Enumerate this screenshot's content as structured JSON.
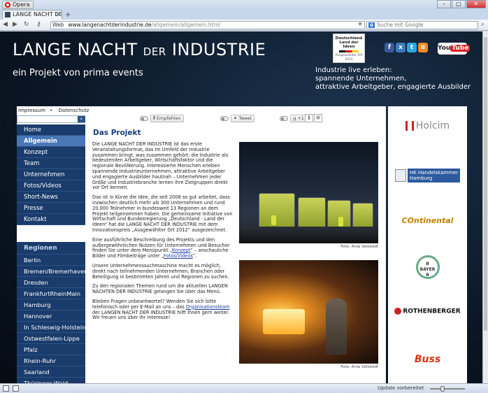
{
  "browser": {
    "app_button": "Opera",
    "tab_title": "LANGE NACHT DER IN...",
    "address_label": "Web",
    "url_host": "www.langenachtderindustrie.de",
    "url_path": "/allgemein/allgemein.html",
    "search_placeholder": "Suche mit Google",
    "status_text": "Update vorbereitet"
  },
  "header": {
    "title_part1": "LANGE NA",
    "title_c": "C",
    "title_part2": "HT",
    "title_der": "DER",
    "title_part3": "INDUSTRIE",
    "subtitle": "ein Projekt von prima events",
    "badge_line1": "Deutschland",
    "badge_line2": "Land der Ideen",
    "badge_line3": "Ausgewählter Ort 2012",
    "youtube_label": "You",
    "youtube_label2": "Tube",
    "tagline_1": "Industrie live erleben:",
    "tagline_2": "spannende Unternehmen,",
    "tagline_3": "attraktive Arbeitgeber, engagierte Ausbilder"
  },
  "topnav": {
    "impressum": "Impressum",
    "datenschutz": "Datenschutz"
  },
  "menu": [
    {
      "label": "Home"
    },
    {
      "label": "Allgemein"
    },
    {
      "label": "Konzept"
    },
    {
      "label": "Team"
    },
    {
      "label": "Unternehmen"
    },
    {
      "label": "Fotos/Videos"
    },
    {
      "label": "Short-News"
    },
    {
      "label": "Presse"
    },
    {
      "label": "Kontakt"
    }
  ],
  "regions": {
    "heading": "Regionen",
    "items": [
      {
        "label": "Berlin"
      },
      {
        "label": "Bremen/Bremerhaven"
      },
      {
        "label": "Dresden"
      },
      {
        "label": "FrankfurtRheinMain"
      },
      {
        "label": "Hamburg"
      },
      {
        "label": "Hannover"
      },
      {
        "label": "In Schleswig-Holstein"
      },
      {
        "label": "Ostwestfalen-Lippe"
      },
      {
        "label": "Pfalz"
      },
      {
        "label": "Rhein-Ruhr"
      },
      {
        "label": "Saarland"
      },
      {
        "label": "Thüringer Wald"
      }
    ]
  },
  "social_buttons": {
    "facebook": "Empfehlen",
    "twitter": "Tweet",
    "gplus": "+1"
  },
  "article": {
    "title": "Das Projekt",
    "p1": "Die LANGE NACHT DER INDUSTRIE ist das erste Veranstaltungsformat, das im Umfeld der Industrie zusammen bringt, was zusammen gehört: die Industrie als bedeutenden Arbeitgeber, Wirtschaftsfaktor und die regionale Bevölkerung. Interessierte Menschen erleben spannende Industrieunternehmen, attraktive Arbeitgeber und engagierte Ausbilder hautnah – Unternehmen jeder Größe und Industriebranche lernen ihre Zielgruppen direkt vor Ort kennen.",
    "p2": "Das ist in Kürze die Idee, die seit 2008 so gut arbeitet, dass inzwischen deutlich mehr als 300 Unternehmen und rund 20.000 Teilnehmer in bundesweit 13 Regionen an dem Projekt teilgenommen haben. Die gemeinsame Initiative von Wirtschaft und Bundesregierung „Deutschland - Land der Ideen“ hat die LANGE NACHT DER INDUSTRIE mit dem Innovationspreis „Ausgewählter Ort 2012“ ausgezeichnet.",
    "p3_a": "Eine ausführliche Beschreibung des Projekts und den außergewöhnlichen Nutzen für Unternehmen und Besucher finden Sie unter dem Menüpunkt „",
    "p3_link1": "Konzept",
    "p3_b": "“ – anschauliche Bilder und Filmbeiträge unter „",
    "p3_link2": "Fotos/Videos",
    "p3_c": "“.",
    "p4": "Unsere Unternehmenssuchmaschine macht es möglich, direkt nach teilnehmenden Unternehmen, Branchen oder Beteiligung in bestimmten Jahren und Regionen zu suchen.",
    "p5": "Zu den regionalen Themen rund um die aktuellen LANGEN NÄCHTEN DER INDUSTRIE gelangen Sie über das Menü.",
    "p6_a": "Blieben Fragen unbeantwortet? Wenden Sie sich bitte telefonisch oder per E-Mail an uns – das ",
    "p6_link": "Organisationsteam",
    "p6_b": " der LANGEN NACHT DER INDUSTRIE hilft Ihnen gern weiter. Wir freuen uns über Ihr Interesse!",
    "caption1": "Foto: Arne Vollstedt",
    "caption2": "Foto: Arne Vollstedt"
  },
  "sponsors": {
    "holcim": "Holcim",
    "hk_line1": "HK",
    "hk_line2": "Handelskammer",
    "hk_line3": "Hamburg",
    "continental": "Ontinental",
    "bayer_1": "B",
    "bayer_2": "BAYER",
    "bayer_3": "R",
    "rothenberger": "ROTHENBERGER",
    "buss": "Buss"
  }
}
